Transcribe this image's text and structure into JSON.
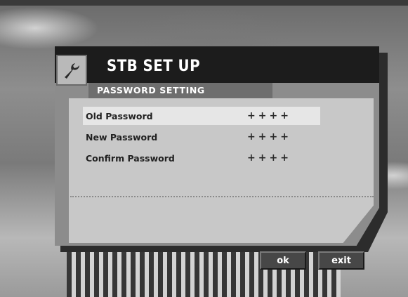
{
  "header": {
    "title": "STB SET UP",
    "icon": "wrench-icon"
  },
  "section": {
    "title": "PASSWORD SETTING"
  },
  "fields": [
    {
      "label": "Old Password",
      "value": "++++",
      "selected": true
    },
    {
      "label": "New Password",
      "value": "++++",
      "selected": false
    },
    {
      "label": "Confirm Password",
      "value": "++++",
      "selected": false
    }
  ],
  "buttons": {
    "ok": "ok",
    "exit": "exit"
  },
  "colors": {
    "header_bg": "#1c1c1c",
    "panel_bg": "#8c8c8c",
    "content_bg": "#c8c8c8",
    "selected_row": "#e6e6e6",
    "button_bg": "#474747"
  }
}
